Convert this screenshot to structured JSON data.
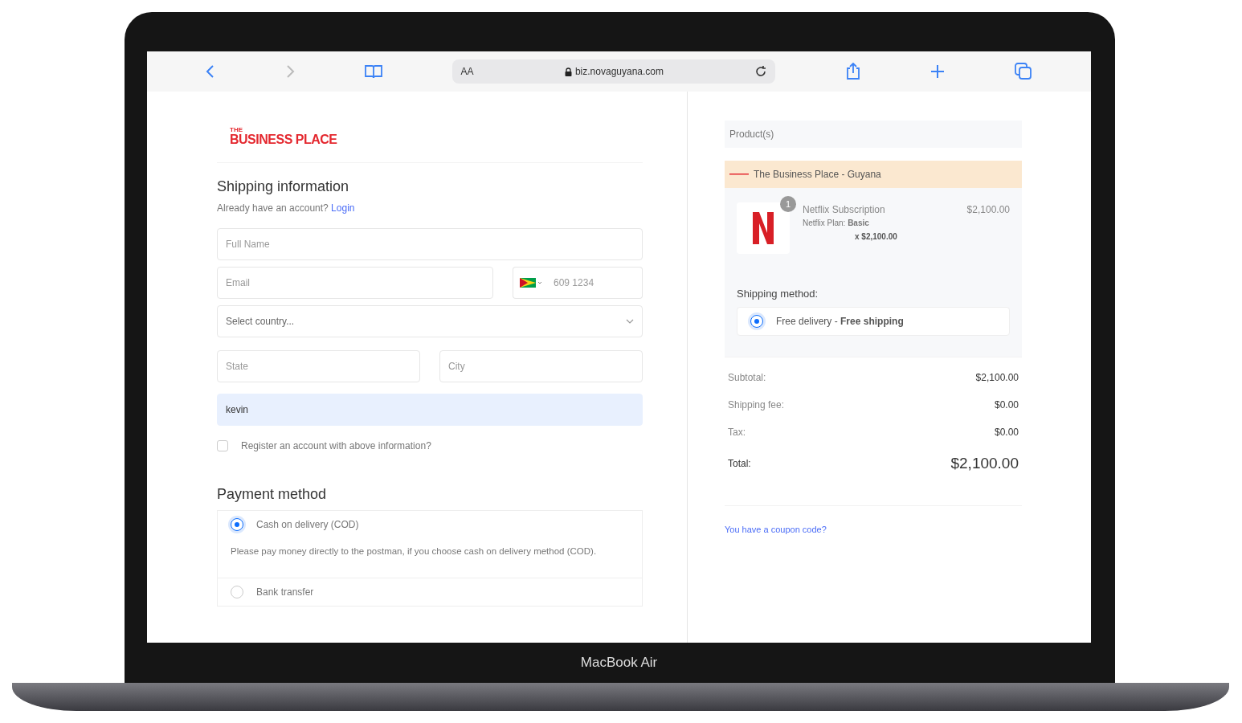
{
  "device": {
    "label": "MacBook Air"
  },
  "browser": {
    "text_size": "AA",
    "address": "biz.novaguyana.com"
  },
  "logo": {
    "small": "THE",
    "name": "BUSINESS PLACE"
  },
  "shipping": {
    "title": "Shipping information",
    "prompt": "Already have an account?",
    "login": "Login",
    "fields": [
      {
        "kind": "text",
        "placeholder": "Full Name"
      },
      {
        "kind": "pair",
        "items": [
          {
            "kind": "text",
            "placeholder": "Email"
          },
          {
            "kind": "phone",
            "placeholder": "609 1234"
          }
        ]
      },
      {
        "kind": "select",
        "placeholder": "Select country..."
      },
      {
        "kind": "pair",
        "items": [
          {
            "kind": "text",
            "placeholder": "State"
          },
          {
            "kind": "text",
            "placeholder": "City"
          }
        ]
      },
      {
        "kind": "autofill",
        "value": "kevin"
      }
    ],
    "register": {
      "label": "Register an account with above information?",
      "checked": false
    }
  },
  "payment": {
    "title": "Payment method",
    "options": [
      {
        "label": "Cash on delivery (COD)",
        "selected": true,
        "description": "Please pay money directly to the postman, if you choose cash on delivery method (COD)."
      },
      {
        "label": "Bank transfer",
        "selected": false
      }
    ]
  },
  "summary": {
    "header": "Product(s)",
    "store": "The Business Place - Guyana",
    "items": [
      {
        "quantity": "1",
        "name": "Netflix Subscription",
        "variant": "Netflix Plan: **Basic**",
        "line": "x $2,100.00",
        "price": "$2,100.00"
      }
    ],
    "shipping_title": "Shipping method:",
    "shipping_options": [
      {
        "label": "Free delivery - **Free shipping**",
        "selected": true
      }
    ],
    "totals": [
      {
        "label": "Subtotal:",
        "value": "$2,100.00"
      },
      {
        "label": "Shipping fee:",
        "value": "$0.00"
      },
      {
        "label": "Tax:",
        "value": "$0.00"
      }
    ],
    "total": {
      "label": "Total:",
      "value": "$2,100.00"
    },
    "coupon": "You have a coupon code?"
  }
}
